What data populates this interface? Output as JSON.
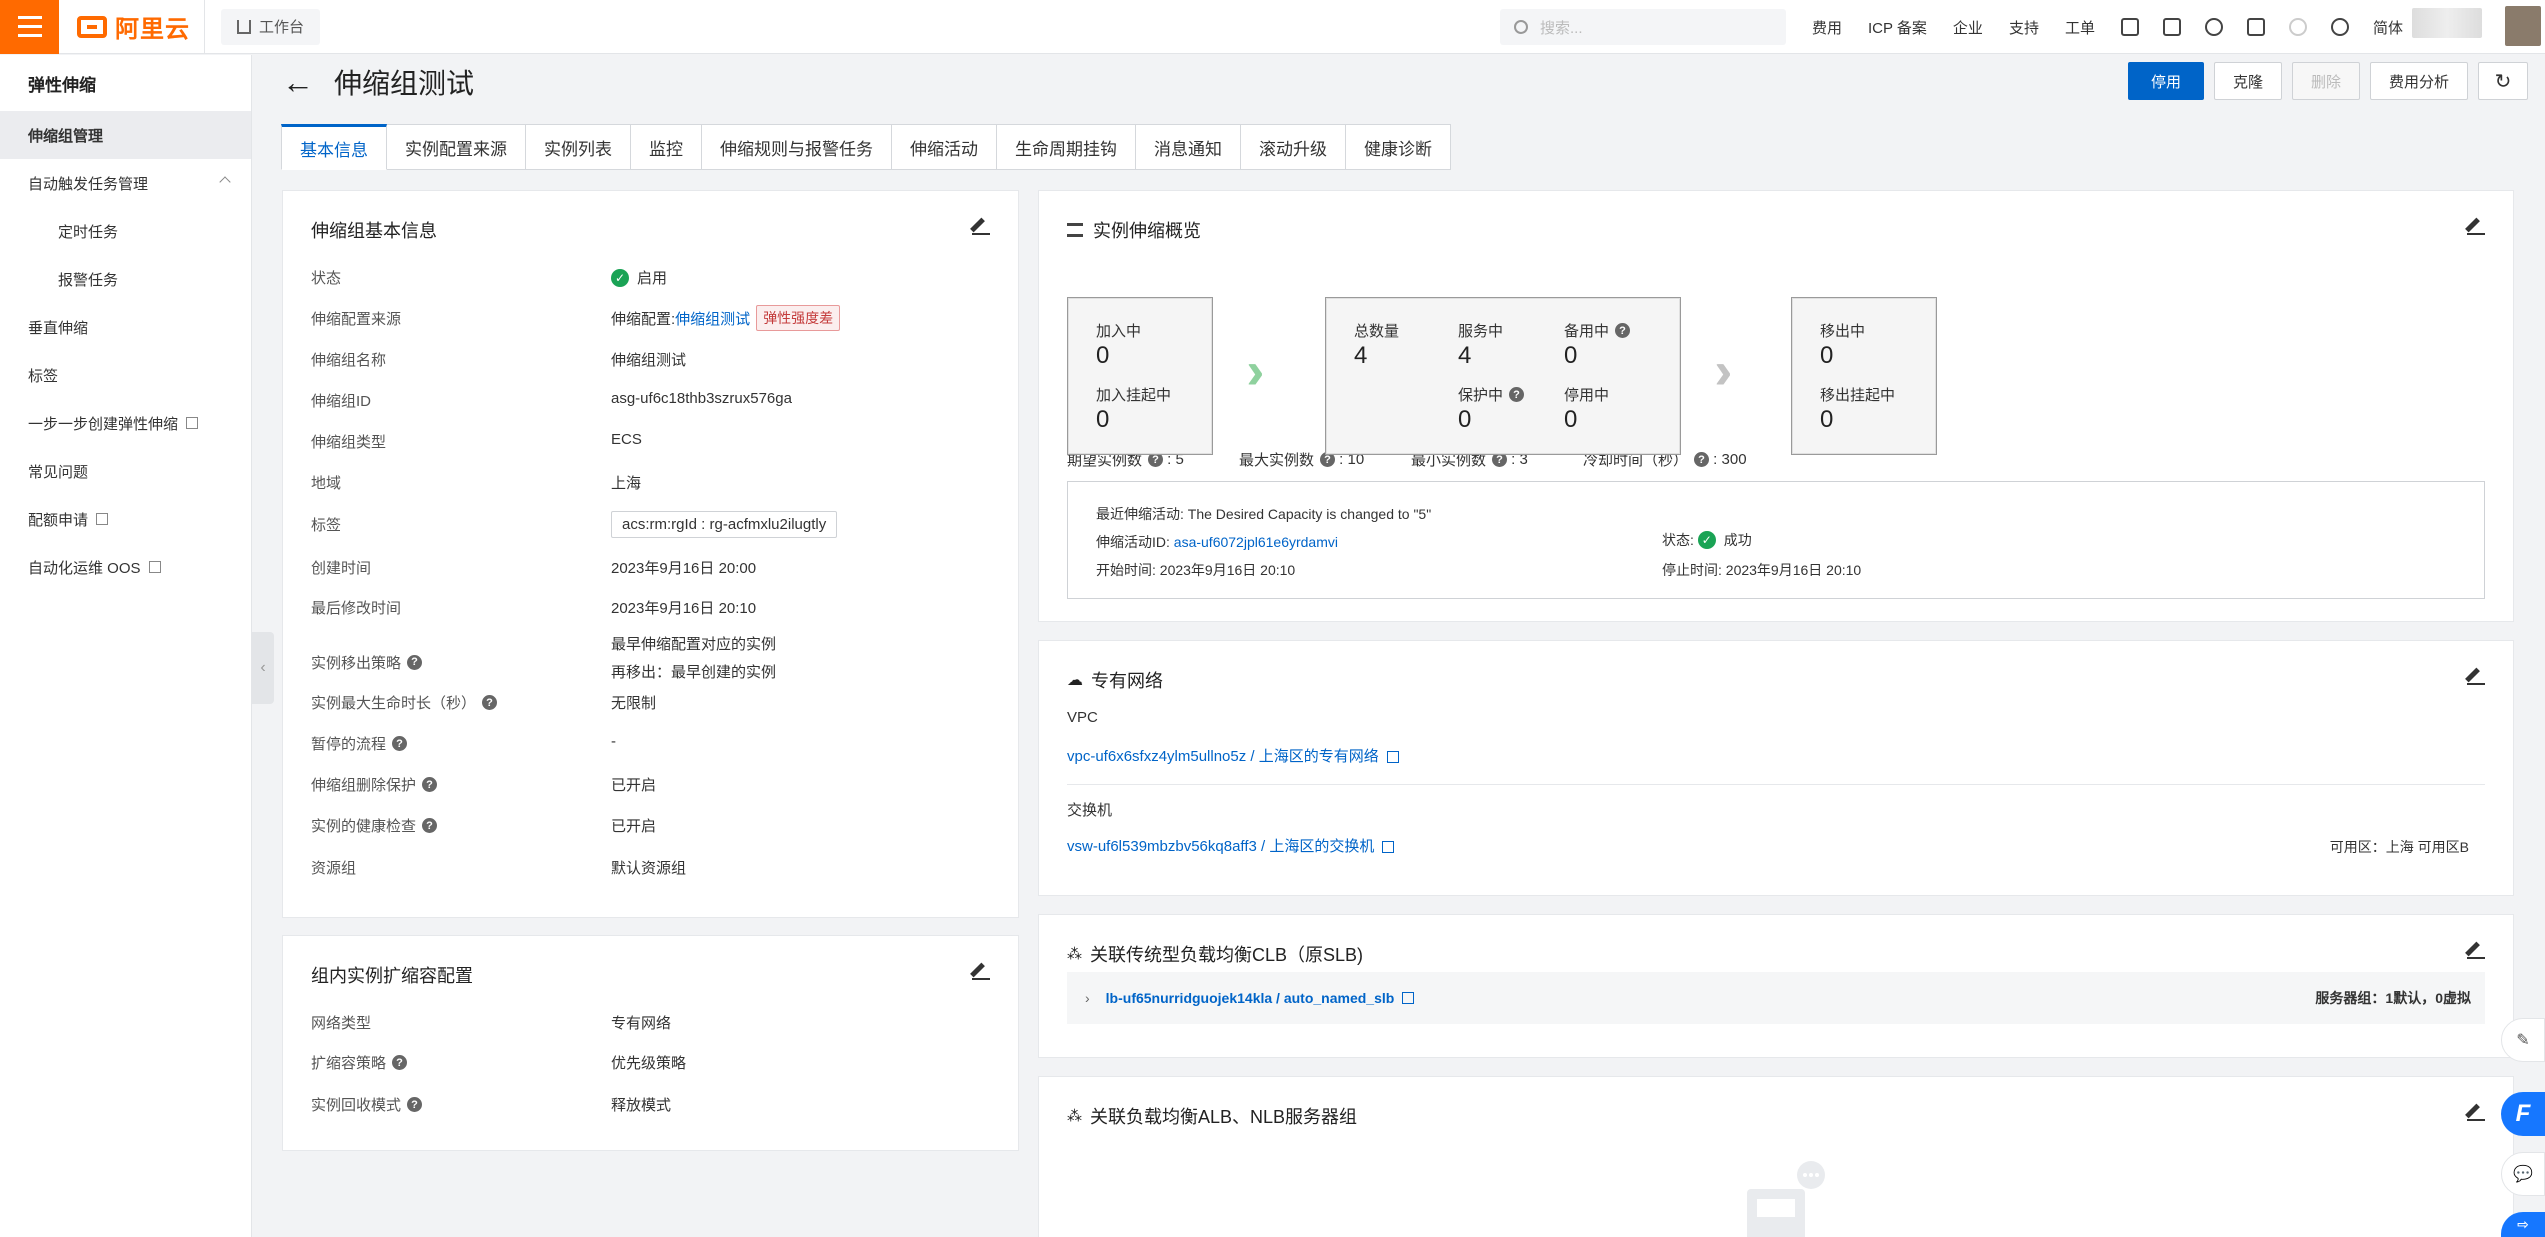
{
  "topbar": {
    "brand": "阿里云",
    "workbench": "工作台",
    "search_placeholder": "搜索...",
    "nav": [
      "费用",
      "ICP 备案",
      "企业",
      "支持",
      "工单"
    ],
    "lang": "简体"
  },
  "sidebar": {
    "title": "弹性伸缩",
    "items": [
      {
        "label": "伸缩组管理"
      },
      {
        "label": "自动触发任务管理"
      },
      {
        "label": "定时任务"
      },
      {
        "label": "报警任务"
      },
      {
        "label": "垂直伸缩"
      },
      {
        "label": "标签"
      },
      {
        "label": "一步一步创建弹性伸缩"
      },
      {
        "label": "常见问题"
      },
      {
        "label": "配额申请"
      },
      {
        "label": "自动化运维 OOS"
      }
    ]
  },
  "header": {
    "title": "伸缩组测试",
    "actions": {
      "disable": "停用",
      "clone": "克隆",
      "delete": "删除",
      "cost": "费用分析"
    }
  },
  "tabs": [
    "基本信息",
    "实例配置来源",
    "实例列表",
    "监控",
    "伸缩规则与报警任务",
    "伸缩活动",
    "生命周期挂钩",
    "消息通知",
    "滚动升级",
    "健康诊断"
  ],
  "basic": {
    "title": "伸缩组基本信息",
    "rows": [
      {
        "k": "状态",
        "v": "启用"
      },
      {
        "k": "伸缩配置来源",
        "v": "伸缩配置:",
        "link": "伸缩组测试",
        "badge": "弹性强度差"
      },
      {
        "k": "伸缩组名称",
        "v": "伸缩组测试"
      },
      {
        "k": "伸缩组ID",
        "v": "asg-uf6c18thb3szrux576ga"
      },
      {
        "k": "伸缩组类型",
        "v": "ECS"
      },
      {
        "k": "地域",
        "v": "上海"
      },
      {
        "k": "标签",
        "v": "acs:rm:rgId : rg-acfmxlu2ilugtly"
      },
      {
        "k": "创建时间",
        "v": "2023年9月16日 20:00"
      },
      {
        "k": "最后修改时间",
        "v": "2023年9月16日 20:10"
      },
      {
        "k": "实例移出策略",
        "v": "最早伸缩配置对应的实例",
        "v2": "再移出：最早创建的实例"
      },
      {
        "k": "实例最大生命时长（秒）",
        "v": "无限制"
      },
      {
        "k": "暂停的流程",
        "v": "-"
      },
      {
        "k": "伸缩组删除保护",
        "v": "已开启"
      },
      {
        "k": "实例的健康检查",
        "v": "已开启"
      },
      {
        "k": "资源组",
        "v": "默认资源组"
      }
    ]
  },
  "scale_cfg": {
    "title": "组内实例扩缩容配置",
    "rows": [
      {
        "k": "网络类型",
        "v": "专有网络"
      },
      {
        "k": "扩缩容策略",
        "v": "优先级策略"
      },
      {
        "k": "实例回收模式",
        "v": "释放模式"
      }
    ]
  },
  "overview": {
    "title": "实例伸缩概览",
    "stats": [
      {
        "k": "期望实例数",
        "v": "5"
      },
      {
        "k": "最大实例数",
        "v": "10"
      },
      {
        "k": "最小实例数",
        "v": "3"
      },
      {
        "k": "冷却时间（秒）",
        "v": "300"
      }
    ],
    "joining": {
      "l1": "加入中",
      "n1": "0",
      "l2": "加入挂起中",
      "n2": "0"
    },
    "center": {
      "total_l": "总数量",
      "total": "4",
      "serving_l": "服务中",
      "serving": "4",
      "standby_l": "备用中",
      "standby": "0",
      "protected_l": "保护中",
      "protected": "0",
      "stopped_l": "停用中",
      "stopped": "0"
    },
    "removing": {
      "l1": "移出中",
      "n1": "0",
      "l2": "移出挂起中",
      "n2": "0"
    },
    "activity": {
      "recent_l": "最近伸缩活动:",
      "recent": "The Desired Capacity is changed to \"5\"",
      "id_l": "伸缩活动ID:",
      "id": "asa-uf6072jpl61e6yrdamvi",
      "status_l": "状态:",
      "status": "成功",
      "start_l": "开始时间:",
      "start": "2023年9月16日 20:10",
      "end_l": "停止时间:",
      "end": "2023年9月16日 20:10"
    }
  },
  "vpc": {
    "title": "专有网络",
    "vpc_l": "VPC",
    "vpc": "vpc-uf6x6sfxz4ylm5ullno5z / 上海区的专有网络",
    "vsw_l": "交换机",
    "vsw": "vsw-uf6l539mbzbv56kq8aff3 / 上海区的交换机",
    "zone": "可用区：上海 可用区B"
  },
  "clb": {
    "title": "关联传统型负载均衡CLB（原SLB)",
    "lb": "lb-uf65nurridguojek14kla / auto_named_slb",
    "servers": "服务器组：1默认，0虚拟"
  },
  "alb": {
    "title": "关联负载均衡ALB、NLB服务器组"
  },
  "colors": {
    "accent": "#0064c8",
    "brand": "#ff6a00",
    "success": "#1aa355"
  }
}
